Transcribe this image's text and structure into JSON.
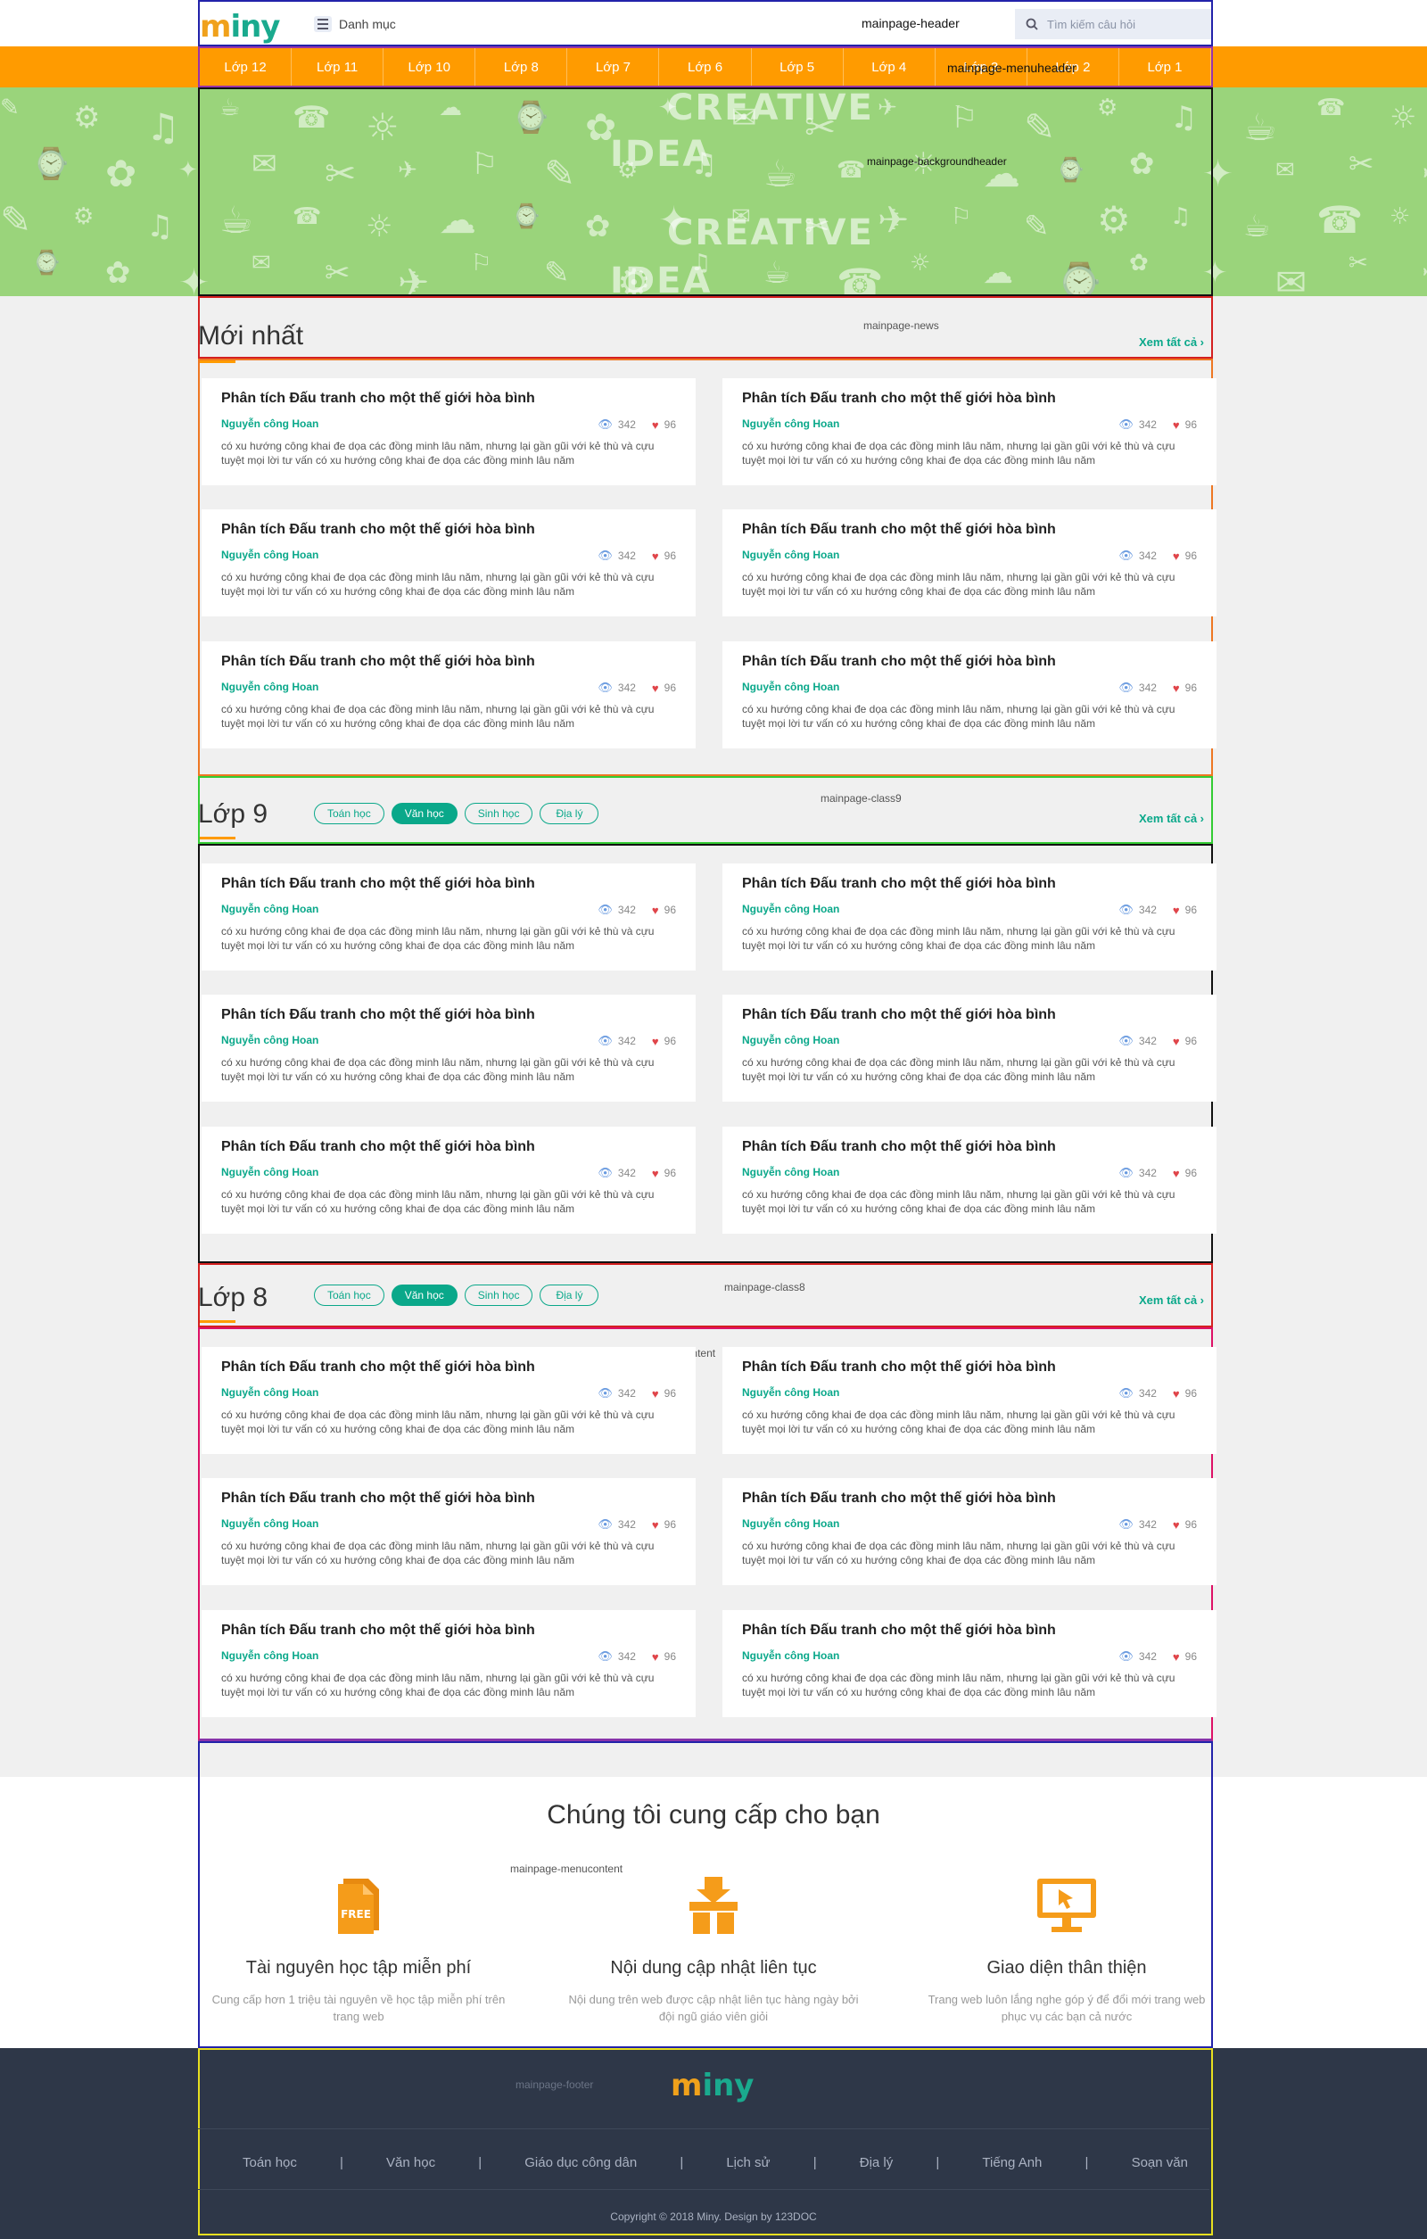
{
  "colors": {
    "accent_orange": "#ff9b00",
    "accent_green": "#0aa88a",
    "banner_green": "#9ad47b",
    "footer_bg": "#2e3748"
  },
  "header": {
    "logo": "miny",
    "menu_label": "Danh mục",
    "tag": "mainpage-header",
    "search_placeholder": "Tìm kiếm câu hỏi",
    "search_icon": "search-icon"
  },
  "menu": {
    "tag": "mainpage-menuheader",
    "items": [
      "Lớp 12",
      "Lớp 11",
      "Lớp 10",
      "Lớp 8",
      "Lớp 7",
      "Lớp 6",
      "Lớp 5",
      "Lớp 4",
      "Lớp 3",
      "Lớp 2",
      "Lớp 1"
    ]
  },
  "banner": {
    "tag": "mainpage-backgroundheader",
    "words": [
      "CREATIVE",
      "IDEA",
      "CREATIVE",
      "IDEA"
    ]
  },
  "news": {
    "title": "Mới nhất",
    "tag": "mainpage-news",
    "content_tag": "mainpage-newscontent",
    "see_all": "Xem tất cả ›"
  },
  "class9": {
    "title": "Lớp 9",
    "tag": "mainpage-class9",
    "content_tag": "mainpage-class9content",
    "see_all": "Xem tất cả ›",
    "chips": [
      "Toán học",
      "Văn học",
      "Sinh học",
      "Địa lý"
    ]
  },
  "class8": {
    "title": "Lớp 8",
    "tag": "mainpage-class8",
    "content_tag": "mainpage-class8content",
    "see_all": "Xem tất cả ›",
    "chips": [
      "Toán học",
      "Văn học",
      "Sinh học",
      "Địa lý"
    ]
  },
  "card": {
    "title": "Phân tích Đấu tranh cho một thế giới hòa bình",
    "author": "Nguyễn công Hoan",
    "views": "342",
    "likes": "96",
    "desc": "có xu hướng công khai đe dọa các đồng minh lâu năm, nhưng lại gần gũi với kẻ thù và cựu tuyệt mọi lời tư vấn có xu hướng công khai đe dọa các đồng minh lâu năm",
    "view_icon": "eye-icon",
    "like_icon": "heart-icon"
  },
  "features": {
    "title": "Chúng tôi cung cấp cho bạn",
    "tag": "mainpage-menucontent",
    "items": [
      {
        "icon": "free-document-icon",
        "badge": "FREE",
        "title": "Tài nguyên học tập miễn phí",
        "desc": "Cung cấp hơn 1 triệu tài nguyên về học tập miễn phí trên trang web"
      },
      {
        "icon": "package-download-icon",
        "title": "Nội dung cập nhật liên tục",
        "desc": "Nội dung trên web được cập nhật liên tục hàng ngày bởi đội ngũ giáo viên giỏi"
      },
      {
        "icon": "monitor-cursor-icon",
        "title": "Giao diện thân thiện",
        "desc": "Trang web luôn lắng nghe góp ý để đổi mới trang web phục vụ các bạn cả nước"
      }
    ]
  },
  "footer": {
    "tag": "mainpage-footer",
    "logo": "miny",
    "links": [
      "Toán học",
      "Văn học",
      "Giáo dục công dân",
      "Lịch sử",
      "Địa lý",
      "Tiếng Anh",
      "Soạn văn"
    ],
    "separator": "|",
    "copyright": "Copyright © 2018 Miny. Design by 123DOC"
  }
}
